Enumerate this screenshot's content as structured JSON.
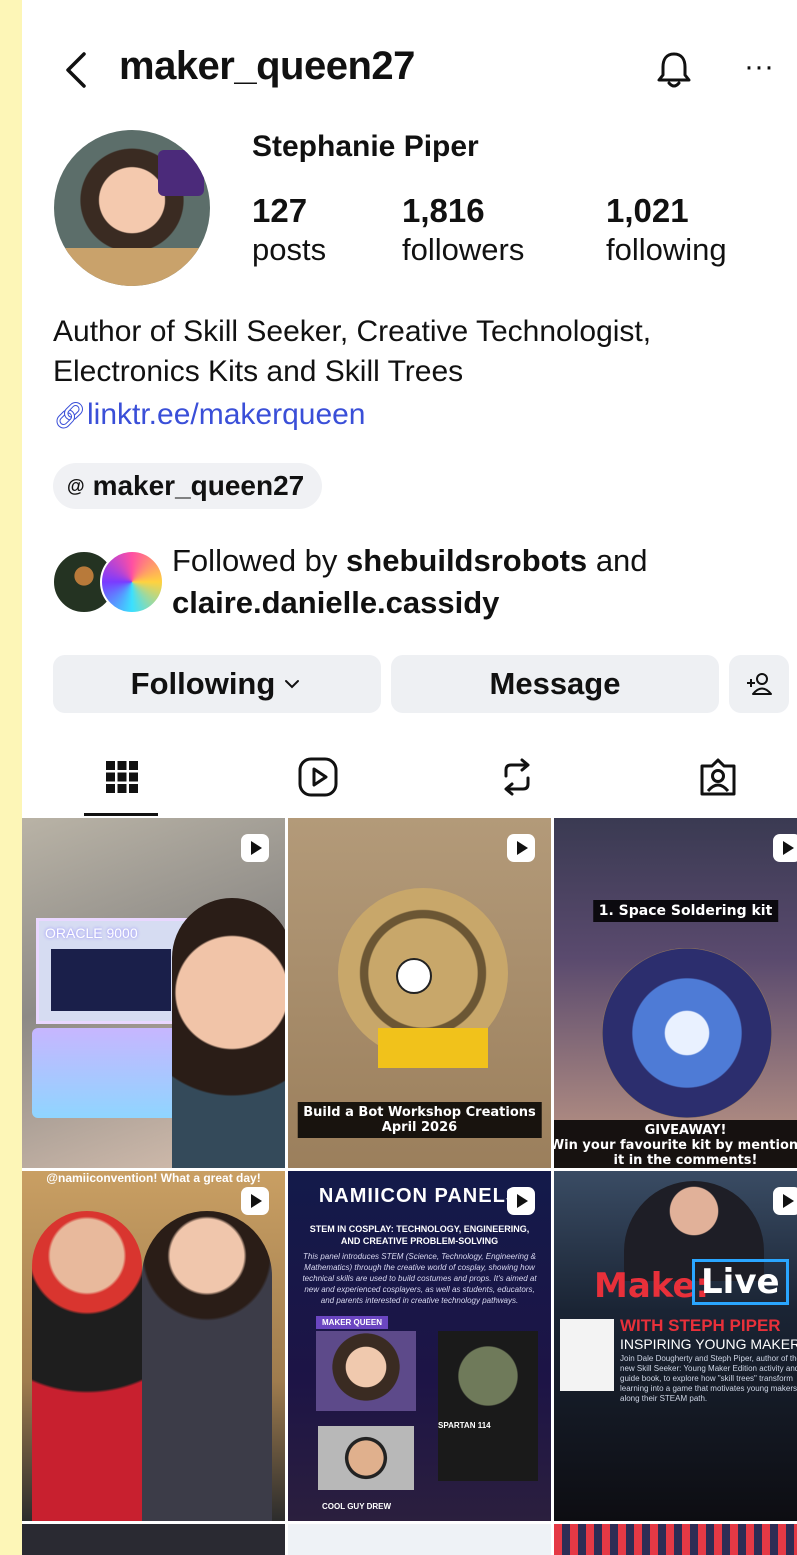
{
  "header": {
    "username": "maker_queen27",
    "more_label": "···"
  },
  "profile": {
    "name": "Stephanie Piper",
    "stats": [
      {
        "value": "127",
        "label": "posts"
      },
      {
        "value": "1,816",
        "label": "followers"
      },
      {
        "value": "1,021",
        "label": "following"
      }
    ],
    "bio_line1": "Author of Skill Seeker, Creative Technologist,",
    "bio_line2": "Electronics Kits and Skill Trees",
    "link": "linktr.ee/makerqueen",
    "threads_handle": "maker_queen27"
  },
  "mutuals": {
    "prefix": "Followed by",
    "first": "shebuildsrobots",
    "joiner": "and",
    "second": "claire.danielle.cassidy"
  },
  "actions": {
    "following": "Following",
    "message": "Message"
  },
  "tabs": [
    {
      "icon": "grid-icon"
    },
    {
      "icon": "reels-icon"
    },
    {
      "icon": "reposts-icon"
    },
    {
      "icon": "tagged-icon"
    }
  ],
  "posts": {
    "p1_screen": "ORACLE 9000",
    "p2_caption": "Build a Bot Workshop Creations",
    "p2_caption2": "April 2026",
    "p3_caption_top": "1. Space Soldering kit",
    "p3_caption_giveaway": "GIVEAWAY!",
    "p3_caption_bottom": "Win your favourite kit by mentioning",
    "p3_caption_bottom2": "it in the comments!",
    "p4_caption": "@namiiconvention! What a great day!",
    "p5_title": "NAMIICON PANELS",
    "p5_sub": "STEM IN COSPLAY: TECHNOLOGY, ENGINEERING, AND CREATIVE PROBLEM-SOLVING",
    "p5_body": "This panel introduces STEM (Science, Technology, Engineering & Mathematics) through the creative world of cosplay, showing how technical skills are used to build costumes and props. It's aimed at new and experienced cosplayers, as well as students, educators, and parents interested in creative technology pathways.",
    "p5_maker": "MAKER QUEEN",
    "p5_spartan": "SPARTAN 114",
    "p5_drew": "COOL GUY DREW",
    "p6_make": "Make:",
    "p6_live": "Live",
    "p6_with": "WITH STEPH PIPER",
    "p6_inspiring": "INSPIRING YOUNG MAKERS",
    "p6_desc": "Join Dale Dougherty and Steph Piper, author of the new Skill Seeker: Young Maker Edition activity and guide book, to explore how \"skill trees\" transform learning into a game that motivates young makers along their STEAM path."
  },
  "colors": {
    "background": "#fdf6b7",
    "link": "#3a4fd8",
    "button": "#eef0f3"
  }
}
